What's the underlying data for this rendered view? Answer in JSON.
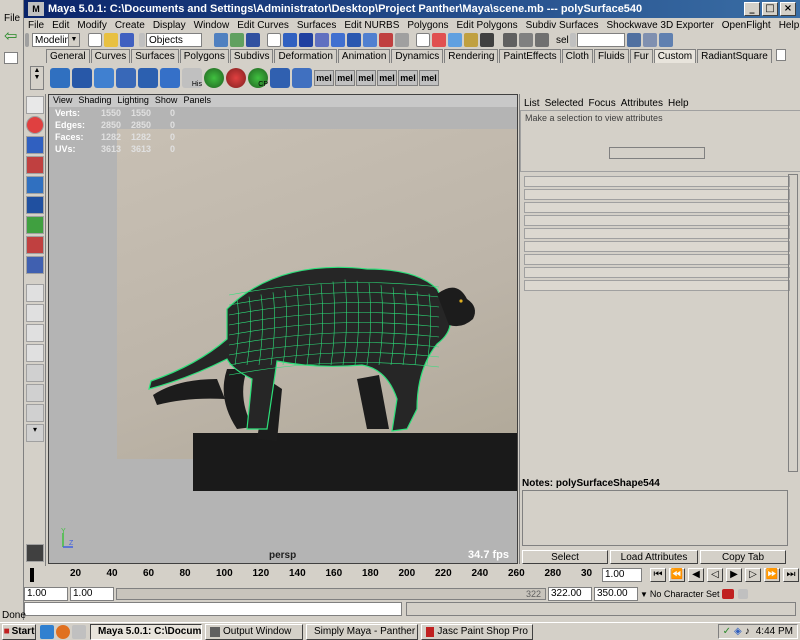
{
  "window": {
    "title": "Maya 5.0.1: C:\\Documents and Settings\\Administrator\\Desktop\\Project Panther\\Maya\\scene.mb  ---  polySurface540",
    "outer_menu_label": "File",
    "outer_status": "Done"
  },
  "menubar": [
    "File",
    "Edit",
    "Modify",
    "Create",
    "Display",
    "Window",
    "Edit Curves",
    "Surfaces",
    "Edit NURBS",
    "Polygons",
    "Edit Polygons",
    "Subdiv Surfaces",
    "Shockwave 3D Exporter",
    "OpenFlight",
    "Help"
  ],
  "statusline": {
    "mode": "Modeling",
    "selection_mask": "Objects",
    "sel_label": "sel"
  },
  "shelf_tabs": [
    "General",
    "Curves",
    "Surfaces",
    "Polygons",
    "Subdivs",
    "Deformation",
    "Animation",
    "Dynamics",
    "Rendering",
    "PaintEffects",
    "Cloth",
    "Fluids",
    "Fur",
    "Custom",
    "RadiantSquare"
  ],
  "shelf_active_tab": "Custom",
  "shelf_icon_labels": {
    "his": "His",
    "cp": "CP"
  },
  "mel_buttons": [
    "mel",
    "mel",
    "mel",
    "mel",
    "mel",
    "mel"
  ],
  "viewport": {
    "menu": [
      "View",
      "Shading",
      "Lighting",
      "Show",
      "Panels"
    ],
    "hud": [
      {
        "label": "Verts:",
        "a": "1550",
        "b": "1550",
        "c": "0"
      },
      {
        "label": "Edges:",
        "a": "2850",
        "b": "2850",
        "c": "0"
      },
      {
        "label": "Faces:",
        "a": "1282",
        "b": "1282",
        "c": "0"
      },
      {
        "label": "UVs:",
        "a": "3613",
        "b": "3613",
        "c": "0"
      }
    ],
    "camera": "persp",
    "fps": "34.7 fps",
    "axis_y": "Y",
    "axis_z": "Z"
  },
  "attribute_editor": {
    "menu": [
      "List",
      "Selected",
      "Focus",
      "Attributes",
      "Help"
    ],
    "hint": "Make a selection to view attributes",
    "notes_label": "Notes:  polySurfaceShape544",
    "buttons": [
      "Select",
      "Load Attributes",
      "Copy Tab"
    ]
  },
  "timeline": {
    "ticks": [
      "20",
      "40",
      "60",
      "80",
      "100",
      "120",
      "140",
      "160",
      "180",
      "200",
      "220",
      "240",
      "260",
      "280",
      "30"
    ],
    "current_frame": "1.00"
  },
  "range": {
    "start": "1.00",
    "playback_start": "1.00",
    "playback_end": "322.00",
    "end": "350.00",
    "range_value": "322",
    "character_set": "No Character Set"
  },
  "taskbar": {
    "start": "Start",
    "items": [
      "Maya 5.0.1: C:\\Docum...",
      "Output Window",
      "Simply Maya - Panther W...",
      "Jasc Paint Shop Pro"
    ],
    "active_index": 0,
    "clock": "4:44 PM"
  },
  "colors": {
    "titlebar": "#0a246a",
    "wireframe": "#2de07a",
    "panther": "#1c1c1c"
  }
}
